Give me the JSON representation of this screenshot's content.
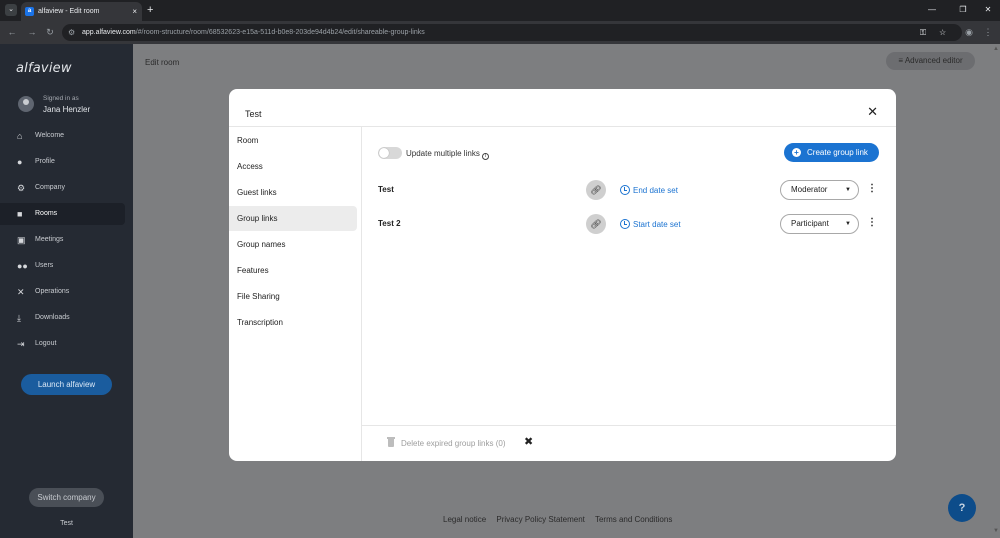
{
  "browser": {
    "tab_title": "alfaview - Edit room",
    "tab_close": "×",
    "new_tab": "+",
    "url_host": "app.alfaview.com",
    "url_path": "/#/room-structure/room/68532623-e15a-511d-b0e8-203de94d4b24/edit/shareable-group-links"
  },
  "sidebar": {
    "brand": "alfaview",
    "signed_in_label": "Signed in as",
    "user_name": "Jana Henzler",
    "items": [
      {
        "label": "Welcome",
        "icon": "home-icon"
      },
      {
        "label": "Profile",
        "icon": "person-icon"
      },
      {
        "label": "Company",
        "icon": "gear-icon"
      },
      {
        "label": "Rooms",
        "icon": "folder-icon"
      },
      {
        "label": "Meetings",
        "icon": "calendar-icon"
      },
      {
        "label": "Users",
        "icon": "users-icon"
      },
      {
        "label": "Operations",
        "icon": "tools-icon"
      },
      {
        "label": "Downloads",
        "icon": "download-icon"
      },
      {
        "label": "Logout",
        "icon": "logout-icon"
      }
    ],
    "active_item": "Rooms",
    "launch_label": "Launch alfaview",
    "switch_label": "Switch company",
    "footer_company": "Test"
  },
  "main": {
    "title": "Edit room",
    "advanced_editor": "Advanced editor",
    "footer": {
      "legal": "Legal notice",
      "privacy": "Privacy Policy Statement",
      "terms": "Terms and Conditions"
    },
    "help_icon": "?"
  },
  "modal": {
    "title": "Test",
    "close": "✕",
    "nav": [
      "Room",
      "Access",
      "Guest links",
      "Group links",
      "Group names",
      "Features",
      "File Sharing",
      "Transcription"
    ],
    "active_nav": "Group links",
    "toggle_label": "Update multiple links",
    "toggle_on": false,
    "create_label": "Create group link",
    "links": [
      {
        "name": "Test",
        "date_label": "End date set",
        "role": "Moderator"
      },
      {
        "name": "Test 2",
        "date_label": "Start date set",
        "role": "Participant"
      }
    ],
    "delete_label": "Delete expired group links (0)"
  },
  "colors": {
    "accent": "#1b73d1",
    "sidebar_bg": "#252a33",
    "launch_btn": "#1a5c9e"
  }
}
